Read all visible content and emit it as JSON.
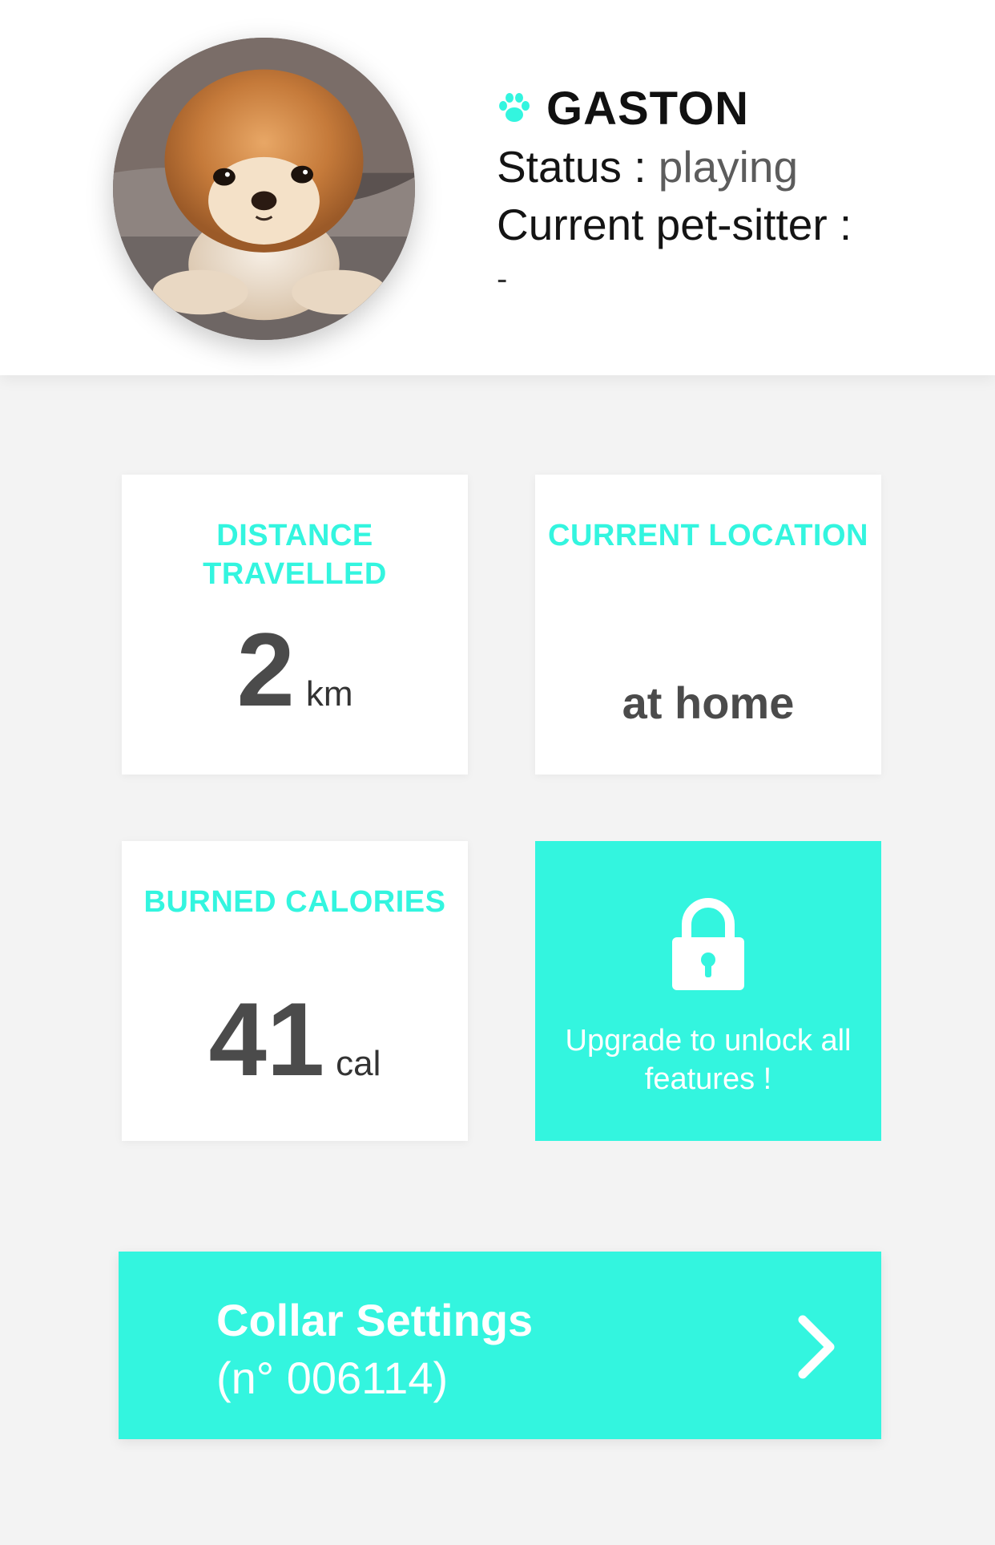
{
  "pet": {
    "name": "GASTON",
    "status_label": "Status : ",
    "status_value": "playing",
    "sitter_label": "Current pet-sitter :",
    "sitter_value": "-"
  },
  "cards": {
    "distance": {
      "title": "DISTANCE TRAVELLED",
      "value": "2",
      "unit": "km"
    },
    "location": {
      "title": "CURRENT LOCATION",
      "value": "at home"
    },
    "calories": {
      "title": "BURNED CALORIES",
      "value": "41",
      "unit": "cal"
    },
    "upgrade": {
      "text": "Upgrade to unlock all features !"
    }
  },
  "collar": {
    "title": "Collar Settings",
    "subtitle": "(n° 006114)"
  },
  "colors": {
    "accent": "#33f5df",
    "text_dark": "#4b4b4b",
    "background": "#f3f3f3"
  },
  "icons": {
    "paw": "paw-icon",
    "lock": "lock-icon",
    "chevron": "chevron-right-icon"
  }
}
